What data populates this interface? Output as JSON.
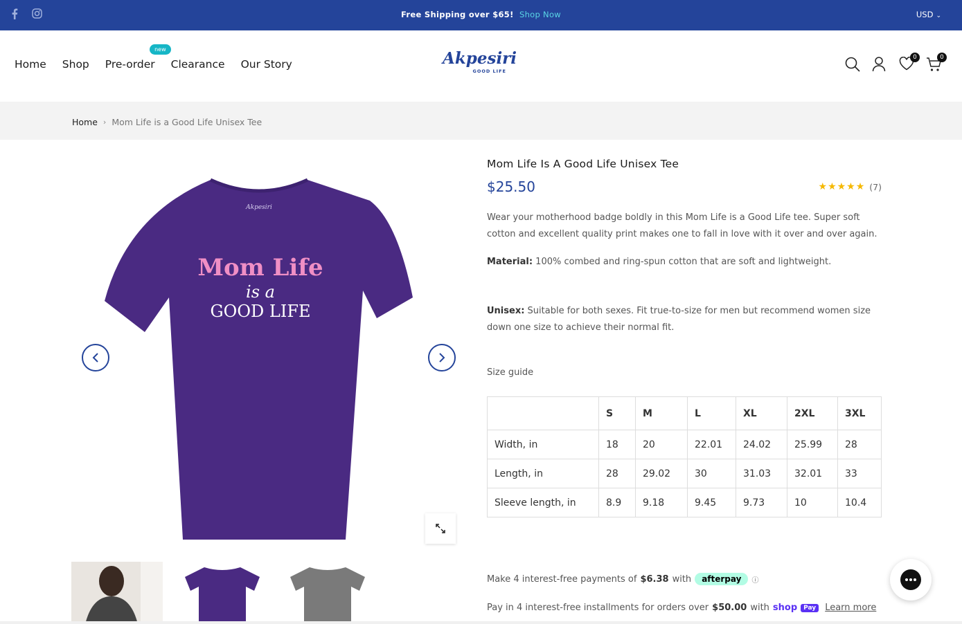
{
  "topbar": {
    "social_icons": [
      "facebook-icon",
      "instagram-icon"
    ],
    "promo_text": "Free Shipping over $65!",
    "promo_link": "Shop Now",
    "currency": "USD"
  },
  "header": {
    "nav": [
      {
        "label": "Home"
      },
      {
        "label": "Shop"
      },
      {
        "label": "Pre-order",
        "badge": "new"
      },
      {
        "label": "Clearance"
      },
      {
        "label": "Our Story"
      }
    ],
    "logo": {
      "brand": "Akpesiri",
      "tagline": "GOOD LIFE"
    },
    "wishlist_count": "0",
    "cart_count": "0"
  },
  "breadcrumb": {
    "home": "Home",
    "current": "Mom Life is a Good Life Unisex Tee"
  },
  "product": {
    "title": "Mom Life Is A Good Life Unisex Tee",
    "price": "$25.50",
    "rating_value": 5,
    "rating_count": "(7)",
    "description": "Wear your motherhood badge boldly in this Mom Life is a Good Life tee. Super soft cotton and excellent quality print makes one to fall in love with it over and over again.",
    "material_label": "Material:",
    "material_text": " 100% combed and ring-spun cotton that are soft and lightweight.",
    "unisex_label": "Unisex:",
    "unisex_text": " Suitable for both sexes. Fit true-to-size for men but recommend women size down one size to achieve their normal fit.",
    "size_guide_label": "Size guide",
    "shirt_print": {
      "line1": "Mom Life",
      "line2": "is a",
      "line3": "GOOD LIFE",
      "collar_brand": "Akpesiri"
    },
    "shirt_color": "#4a2a82"
  },
  "size_table": {
    "headers": [
      "",
      "S",
      "M",
      "L",
      "XL",
      "2XL",
      "3XL"
    ],
    "rows": [
      [
        "Width, in",
        "18",
        "20",
        "22.01",
        "24.02",
        "25.99",
        "28"
      ],
      [
        "Length, in",
        "28",
        "29.02",
        "30",
        "31.03",
        "32.01",
        "33"
      ],
      [
        "Sleeve length, in",
        "8.9",
        "9.18",
        "9.45",
        "9.73",
        "10",
        "10.4"
      ]
    ]
  },
  "afterpay": {
    "prefix": "Make 4 interest-free payments of",
    "amount": "$6.38",
    "with": "with",
    "badge": "afterpay",
    "info": "ⓘ"
  },
  "shoppay": {
    "prefix": "Pay in 4 interest-free installments for orders over",
    "amount": "$50.00",
    "with": "with",
    "logo": "shop",
    "pay": "Pay",
    "learn_more": "Learn more"
  },
  "colors": {
    "brand_blue": "#24449a",
    "accent_teal": "#16b6c6",
    "star_yellow": "#f5b800"
  }
}
